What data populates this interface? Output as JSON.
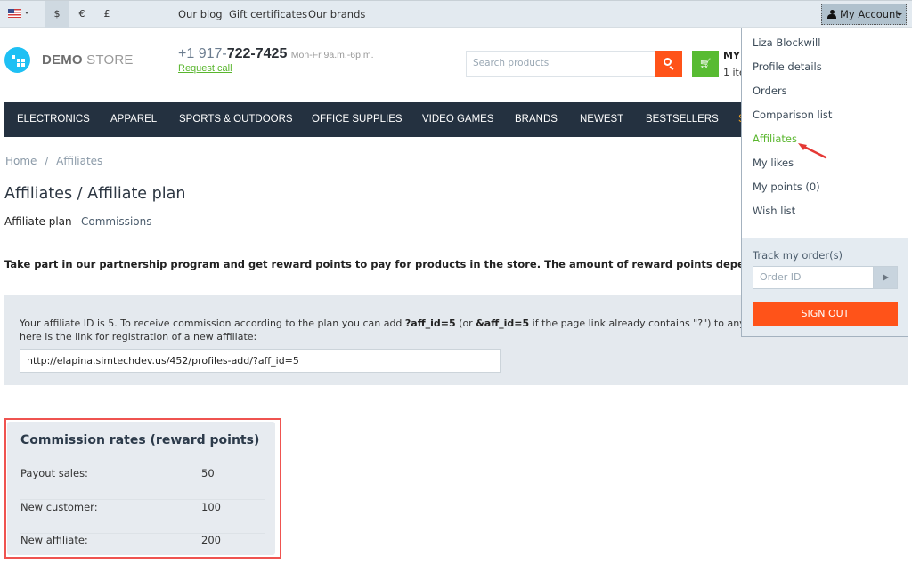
{
  "topbar": {
    "language_icon": "us-flag-icon",
    "currencies": [
      {
        "symbol": "$",
        "active": true
      },
      {
        "symbol": "€",
        "active": false
      },
      {
        "symbol": "£",
        "active": false
      }
    ],
    "links": [
      "Our blog",
      "Gift certificates",
      "Our brands"
    ],
    "account_label": "My Account"
  },
  "header": {
    "logo_bold": "DEMO",
    "logo_light": " STORE",
    "phone_prefix": "+1 917-",
    "phone_main": "722-7425",
    "hours": "Mon-Fr 9a.m.-6p.m.",
    "request_call": "Request call",
    "search_placeholder": "Search products",
    "cart_title": "MY",
    "cart_sub": "1 ite",
    "cart_icon": "cart-icon",
    "search_icon": "search-icon"
  },
  "nav": {
    "items": [
      "ELECTRONICS",
      "APPAREL",
      "SPORTS & OUTDOORS",
      "OFFICE SUPPLIES",
      "VIDEO GAMES",
      "BRANDS",
      "NEWEST",
      "BESTSELLERS",
      "S"
    ]
  },
  "breadcrumb": {
    "home": "Home",
    "separator": "/",
    "current": "Affiliates"
  },
  "page": {
    "title": "Affiliates / Affiliate plan",
    "tabs": [
      {
        "label": "Affiliate plan",
        "active": true
      },
      {
        "label": "Commissions",
        "active": false
      }
    ],
    "intro": "Take part in our partnership program and get reward points to pay for products in the store. The amount of reward points depends on the co"
  },
  "affiliate_info": {
    "text_1": "Your affiliate ID is 5. To receive commission according to the plan you can add ",
    "code_1": "?aff_id=5",
    "text_2": " (or ",
    "code_2": "&aff_id=5",
    "text_3": " if the page link already contains \"?\") to any lin",
    "line_2": "here is the link for registration of a new affiliate:",
    "link_value": "http://elapina.simtechdev.us/452/profiles-add/?aff_id=5"
  },
  "commission": {
    "title": "Commission rates (reward points)",
    "rows": [
      {
        "label": "Payout sales:",
        "value": "50"
      },
      {
        "label": "New customer:",
        "value": "100"
      },
      {
        "label": "New affiliate:",
        "value": "200"
      }
    ]
  },
  "account_menu": {
    "items": [
      {
        "label": "Liza Blockwill",
        "active": false
      },
      {
        "label": "Profile details",
        "active": false
      },
      {
        "label": "Orders",
        "active": false
      },
      {
        "label": "Comparison list",
        "active": false
      },
      {
        "label": "Affiliates",
        "active": true
      },
      {
        "label": "My likes",
        "active": false
      },
      {
        "label": "My points (0)",
        "active": false
      },
      {
        "label": "Wish list",
        "active": false
      }
    ],
    "track_label": "Track my order(s)",
    "order_placeholder": "Order ID",
    "sign_out": "SIGN OUT"
  },
  "colors": {
    "accent_orange": "#ff5319",
    "accent_green": "#59b62d",
    "nav_bg": "#243140",
    "highlight_red": "#ef5350"
  }
}
